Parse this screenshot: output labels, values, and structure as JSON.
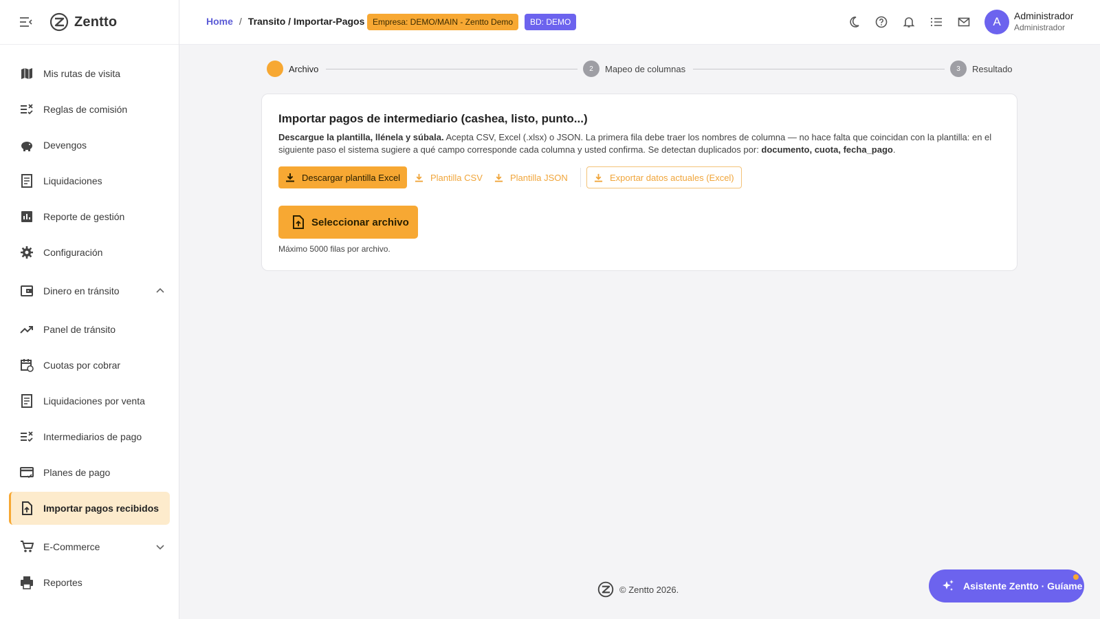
{
  "app": {
    "brand": "Zentto"
  },
  "sidebar": {
    "items": [
      {
        "label": "Mis rutas de visita",
        "icon": "map-icon"
      },
      {
        "label": "Reglas de comisión",
        "icon": "checklist-x-icon"
      },
      {
        "label": "Devengos",
        "icon": "piggy-bank-icon"
      },
      {
        "label": "Liquidaciones",
        "icon": "receipt-icon"
      },
      {
        "label": "Reporte de gestión",
        "icon": "bar-chart-icon"
      },
      {
        "label": "Configuración",
        "icon": "gear-icon"
      },
      {
        "label": "Dinero en tránsito",
        "icon": "wallet-icon",
        "expanded": true
      },
      {
        "label": "Panel de tránsito",
        "icon": "trend-up-icon"
      },
      {
        "label": "Cuotas por cobrar",
        "icon": "calendar-refresh-icon"
      },
      {
        "label": "Liquidaciones por venta",
        "icon": "receipt-icon"
      },
      {
        "label": "Intermediarios de pago",
        "icon": "checklist-x-icon"
      },
      {
        "label": "Planes de pago",
        "icon": "card-check-icon"
      },
      {
        "label": "Importar pagos recibidos",
        "icon": "file-upload-icon",
        "active": true
      },
      {
        "label": "E-Commerce",
        "icon": "cart-icon",
        "expanded": false
      },
      {
        "label": "Reportes",
        "icon": "printer-icon"
      }
    ]
  },
  "topbar": {
    "breadcrumb_home": "Home",
    "breadcrumb_sep": "/",
    "breadcrumb_current": "Transito / Importar-Pagos",
    "badge_company": "Empresa: DEMO/MAIN - Zentto Demo",
    "badge_db": "BD: DEMO",
    "icons": [
      "moon-icon",
      "help-icon",
      "bell-icon",
      "list-icon",
      "mail-icon"
    ],
    "avatar_letter": "A",
    "user_name": "Administrador",
    "user_role": "Administrador"
  },
  "stepper": {
    "steps": [
      {
        "number": "",
        "label": "Archivo",
        "active": true
      },
      {
        "number": "2",
        "label": "Mapeo de columnas",
        "active": false
      },
      {
        "number": "3",
        "label": "Resultado",
        "active": false
      }
    ]
  },
  "card": {
    "title": "Importar pagos de intermediario (cashea, listo, punto...)",
    "desc_bold": "Descargue la plantilla, llénela y súbala.",
    "desc_text": " Acepta CSV, Excel (.xlsx) o JSON. La primera fila debe traer los nombres de columna — no hace falta que coincidan con la plantilla: en el siguiente paso el sistema sugiere a qué campo corresponde cada columna y usted confirma. Se detectan duplicados por: ",
    "desc_keys": "documento, cuota, fecha_pago",
    "desc_end": ".",
    "btn_excel": "Descargar plantilla Excel",
    "btn_csv": "Plantilla CSV",
    "btn_json": "Plantilla JSON",
    "btn_export": "Exportar datos actuales (Excel)",
    "btn_select": "Seleccionar archivo",
    "note": "Máximo 5000 filas por archivo."
  },
  "footer": {
    "text": "© Zentto 2026."
  },
  "assistant": {
    "label": "Asistente Zentto · Guíame"
  },
  "colors": {
    "accent": "#f7a833",
    "brand": "#6c63ee",
    "active_bg": "#fdebcc"
  }
}
